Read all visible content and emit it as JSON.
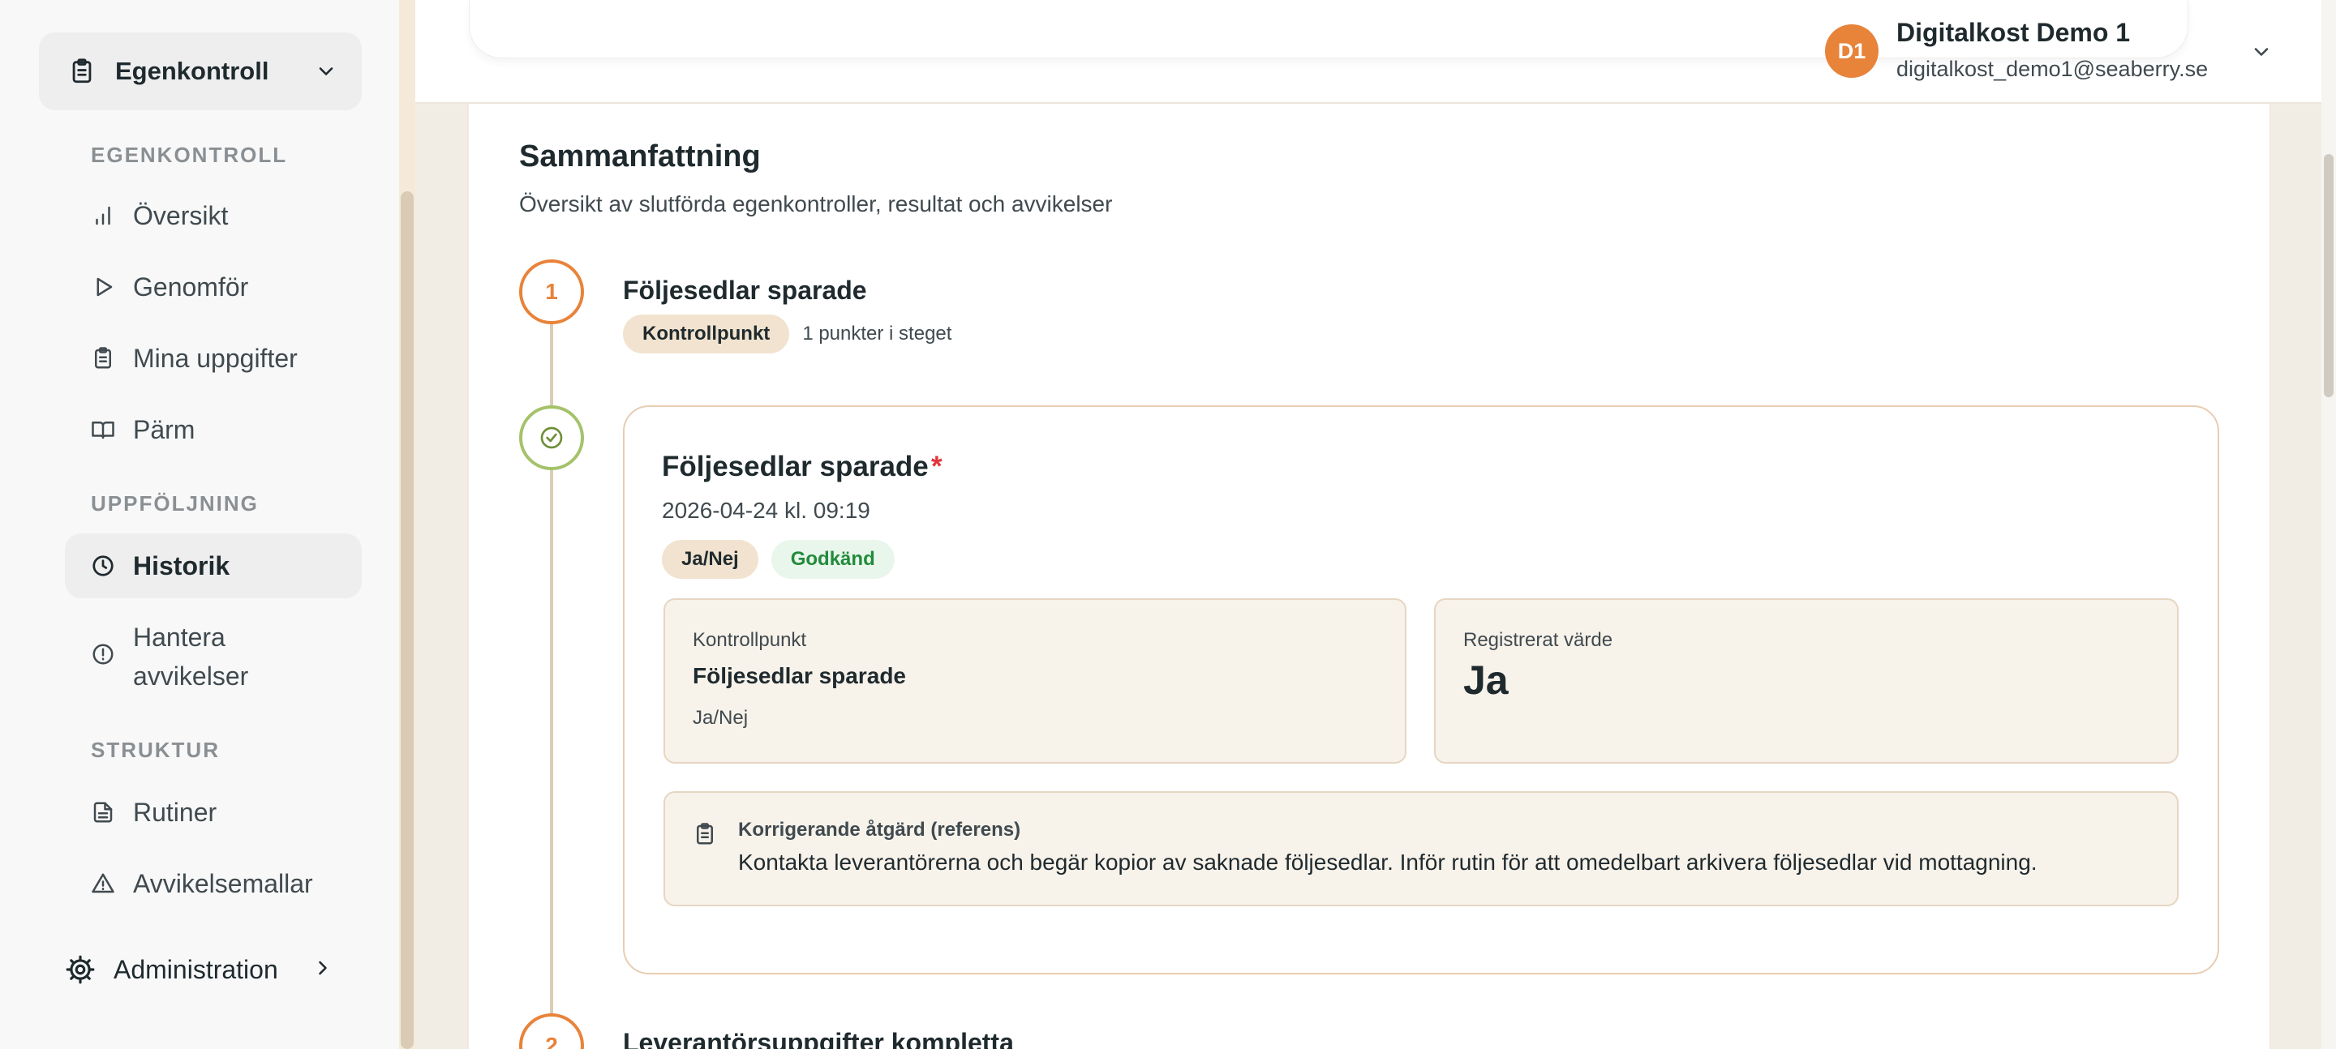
{
  "sidebar": {
    "module": {
      "label": "Egenkontroll",
      "icon": "clipboard-icon"
    },
    "sections": [
      {
        "heading": "EGENKONTROLL",
        "items": [
          {
            "label": "Översikt",
            "icon": "bar-chart-icon"
          },
          {
            "label": "Genomför",
            "icon": "play-icon"
          },
          {
            "label": "Mina uppgifter",
            "icon": "clipboard-list-icon"
          },
          {
            "label": "Pärm",
            "icon": "book-open-icon"
          }
        ]
      },
      {
        "heading": "UPPFÖLJNING",
        "items": [
          {
            "label": "Historik",
            "icon": "clock-icon",
            "active": true
          },
          {
            "label": "Hantera avvikelser",
            "icon": "alert-circle-icon"
          }
        ]
      },
      {
        "heading": "STRUKTUR",
        "items": [
          {
            "label": "Rutiner",
            "icon": "file-text-icon"
          },
          {
            "label": "Avvikelsemallar",
            "icon": "alert-triangle-icon"
          }
        ]
      }
    ],
    "admin": {
      "label": "Administration",
      "icon": "gear-icon"
    }
  },
  "header": {
    "avatar_initials": "D1",
    "user_name": "Digitalkost Demo 1",
    "user_email": "digitalkost_demo1@seaberry.se"
  },
  "page": {
    "title": "Sammanfattning",
    "subtitle": "Översikt av slutförda egenkontroller, resultat och avvikelser"
  },
  "steps": [
    {
      "number": "1",
      "title": "Följesedlar sparade",
      "chip": "Kontrollpunkt",
      "count_text": "1 punkter i steget",
      "result": {
        "title": "Följesedlar sparade",
        "required_mark": "*",
        "date": "2026-04-24 kl. 09:19",
        "type_chip": "Ja/Nej",
        "status_chip": "Godkänd",
        "checkpoint_label": "Kontrollpunkt",
        "checkpoint_name": "Följesedlar sparade",
        "checkpoint_type": "Ja/Nej",
        "value_label": "Registrerat värde",
        "value": "Ja",
        "action_label": "Korrigerande åtgärd (referens)",
        "action_text": "Kontakta leverantörerna och begär kopior av saknade följesedlar. Inför rutin för att omedelbart arkivera följesedlar vid mottagning."
      }
    },
    {
      "number": "2",
      "title": "Leverantörsuppgifter kompletta"
    }
  ],
  "colors": {
    "accent_orange": "#e8833a",
    "success_green": "#a5c26a",
    "required_red": "#e0343c",
    "sidebar_bg": "#f8f8f8",
    "beige_chip": "#f1e3cf"
  }
}
